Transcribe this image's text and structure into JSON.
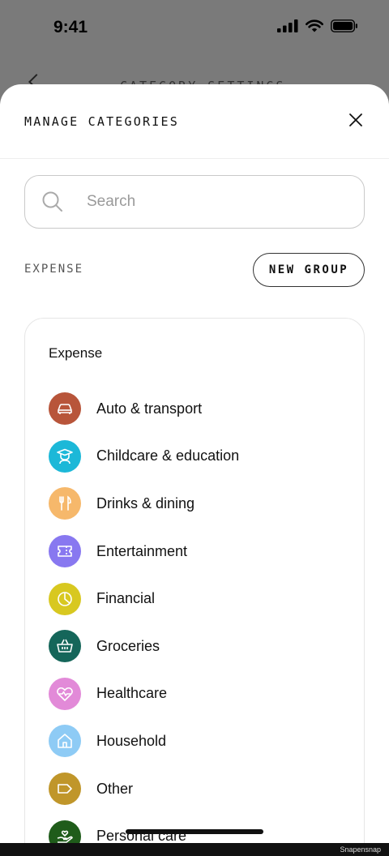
{
  "status_bar": {
    "time": "9:41"
  },
  "background": {
    "heading": "CATEGORY SETTINGS"
  },
  "sheet": {
    "title": "MANAGE CATEGORIES",
    "search": {
      "placeholder": "Search",
      "value": ""
    },
    "section_label": "EXPENSE",
    "new_group_label": "NEW GROUP",
    "group": {
      "title": "Expense",
      "categories": [
        {
          "label": "Auto & transport",
          "color": "#b8553a",
          "icon": "car-icon"
        },
        {
          "label": "Childcare & education",
          "color": "#1cb8d8",
          "icon": "graduate-icon"
        },
        {
          "label": "Drinks & dining",
          "color": "#f6b86b",
          "icon": "utensils-icon"
        },
        {
          "label": "Entertainment",
          "color": "#8878f0",
          "icon": "ticket-icon"
        },
        {
          "label": "Financial",
          "color": "#d8c820",
          "icon": "pie-chart-icon"
        },
        {
          "label": "Groceries",
          "color": "#15665a",
          "icon": "basket-icon"
        },
        {
          "label": "Healthcare",
          "color": "#e28ad8",
          "icon": "heart-pulse-icon"
        },
        {
          "label": "Household",
          "color": "#8ecbf5",
          "icon": "house-icon"
        },
        {
          "label": "Other",
          "color": "#c0962a",
          "icon": "tag-icon"
        },
        {
          "label": "Personal care",
          "color": "#1f5c1a",
          "icon": "hand-heart-icon"
        }
      ]
    }
  },
  "watermark": "Snapensnap"
}
